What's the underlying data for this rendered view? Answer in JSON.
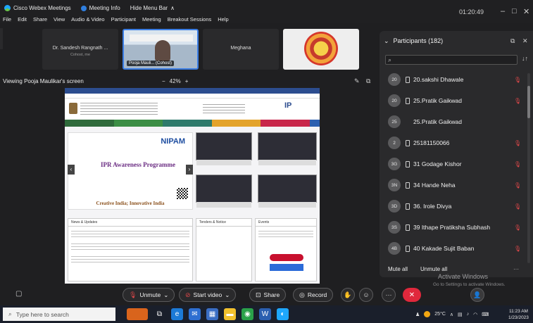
{
  "titlebar": {
    "app_name": "Cisco Webex Meetings",
    "meeting_info": "Meeting Info",
    "hide_menu": "Hide Menu Bar",
    "hide_menu_arrow": "∧",
    "timer": "01:20:49",
    "menu": [
      "File",
      "Edit",
      "Share",
      "View",
      "Audio & Video",
      "Participant",
      "Meeting",
      "Breakout Sessions",
      "Help"
    ]
  },
  "video_strip": [
    {
      "name": "Dr. Sandesh Rangnath ...",
      "sub": "Cohost, me"
    },
    {
      "name": "Pooja Mauli... (Cohost)"
    },
    {
      "name": "Meghana"
    },
    {
      "name": ""
    }
  ],
  "share": {
    "title": "Viewing Pooja Maulikar's screen",
    "zoom_minus": "−",
    "zoom_level": "42%",
    "zoom_plus": "+",
    "site": {
      "logo_text": "NIPAM",
      "banner_title": "IPR Awareness Programme",
      "banner_footer": "Creative India; Innovative India",
      "ip_logo": "IP",
      "news_heading": "News & Updates",
      "tenders_heading": "Tenders & Notice",
      "events_heading": "Events"
    }
  },
  "participants": {
    "title": "Participants (182)",
    "sort_icon_text": "↓↑",
    "list": [
      {
        "initials": "20",
        "name": "20.sakshi Dhawale",
        "muted": true
      },
      {
        "initials": "20",
        "name": "25.Pratik Gaikwad",
        "muted": true
      },
      {
        "initials": "25",
        "name": "25.Pratik Gaikwad",
        "muted": false
      },
      {
        "initials": "2",
        "name": "25181150066",
        "muted": true
      },
      {
        "initials": "3G",
        "name": "31 Godage Kishor",
        "muted": true
      },
      {
        "initials": "3N",
        "name": "34 Hande Neha",
        "muted": true
      },
      {
        "initials": "3D",
        "name": "36. Irole Divya",
        "muted": true
      },
      {
        "initials": "3S",
        "name": "39 Ithape Pratiksha Subhash",
        "muted": true
      },
      {
        "initials": "4B",
        "name": "40 Kakade Sujit Baban",
        "muted": true
      }
    ],
    "mute_all": "Mute all",
    "unmute_all": "Unmute all",
    "more": "···"
  },
  "controls": {
    "unmute": "Unmute",
    "start_video": "Start video",
    "share": "Share",
    "record": "Record"
  },
  "watermark": {
    "line1": "Activate Windows",
    "line2": "Go to Settings to activate Windows."
  },
  "taskbar": {
    "search_placeholder": "Type here to search",
    "weather": "25°C",
    "time": "11:23 AM",
    "date": "1/23/2023"
  }
}
